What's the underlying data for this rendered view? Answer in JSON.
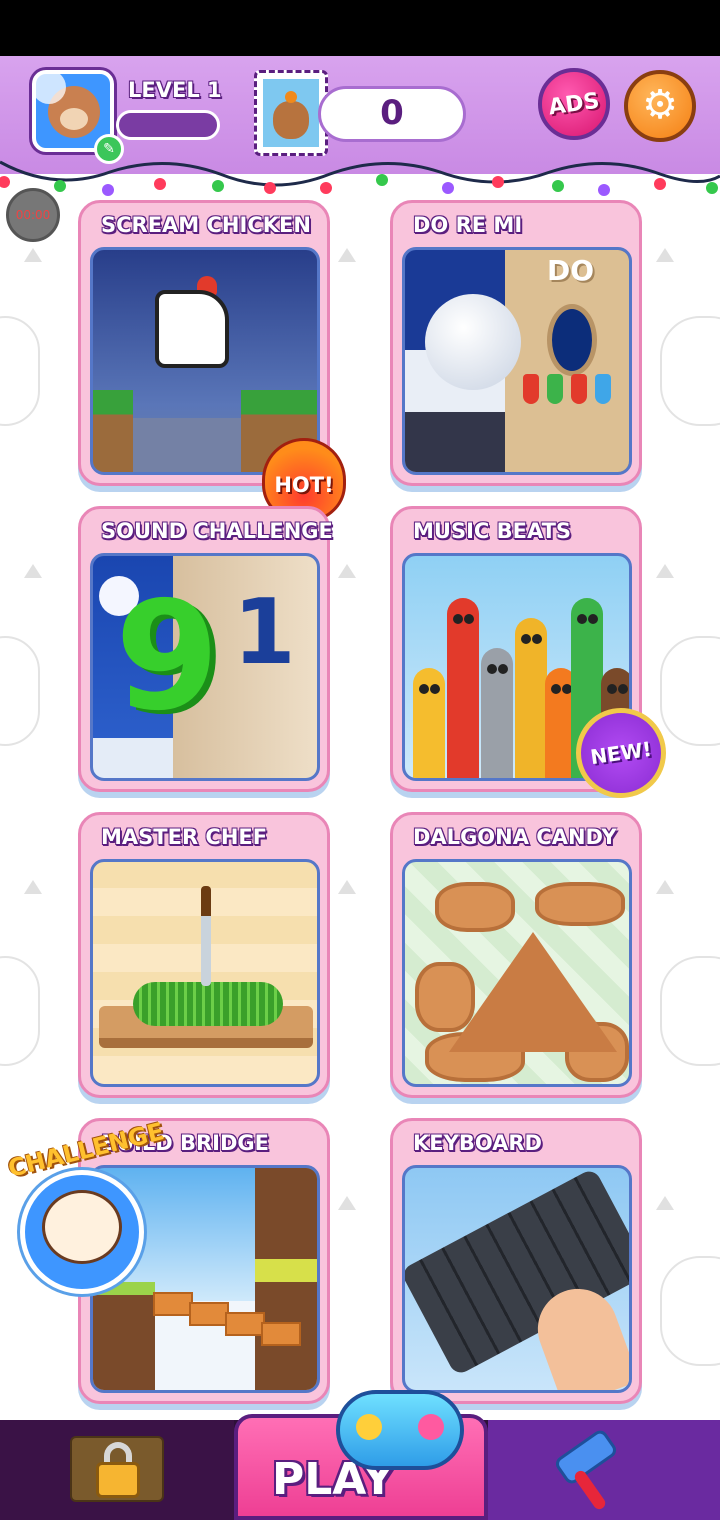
{
  "header": {
    "level_label": "LEVEL 1",
    "level_progress": 0.0,
    "coins": "0",
    "ads_label": "ADS",
    "settings_icon": "gear-icon",
    "edit_icon": "pencil-icon"
  },
  "record": {
    "time": "00:00"
  },
  "games": [
    {
      "title": "SCREAM CHICKEN",
      "badge": "HOT!"
    },
    {
      "title": "DO RE MI",
      "thumb_text": "DO"
    },
    {
      "title": "SOUND CHALLENGE",
      "thumb_digits": [
        "9",
        "1"
      ]
    },
    {
      "title": "MUSIC BEATS",
      "badge": "NEW!"
    },
    {
      "title": "MASTER CHEF"
    },
    {
      "title": "DALGONA CANDY"
    },
    {
      "title": "BUILD BRIDGE"
    },
    {
      "title": "KEYBOARD"
    }
  ],
  "challenge": {
    "label": "CHALLENGE"
  },
  "bottom_nav": {
    "lock_icon": "padlock-icon",
    "play_label": "PLAY",
    "gamepad_icon": "gamepad-icon",
    "paint_icon": "paint-roller-icon"
  },
  "colors": {
    "header_bg": "#d8a3ee",
    "card_bg": "#f9c4dc",
    "play_pink": "#ee3f94",
    "nav_dark": "#2e1038",
    "text_outline": "#5a1e7f"
  }
}
